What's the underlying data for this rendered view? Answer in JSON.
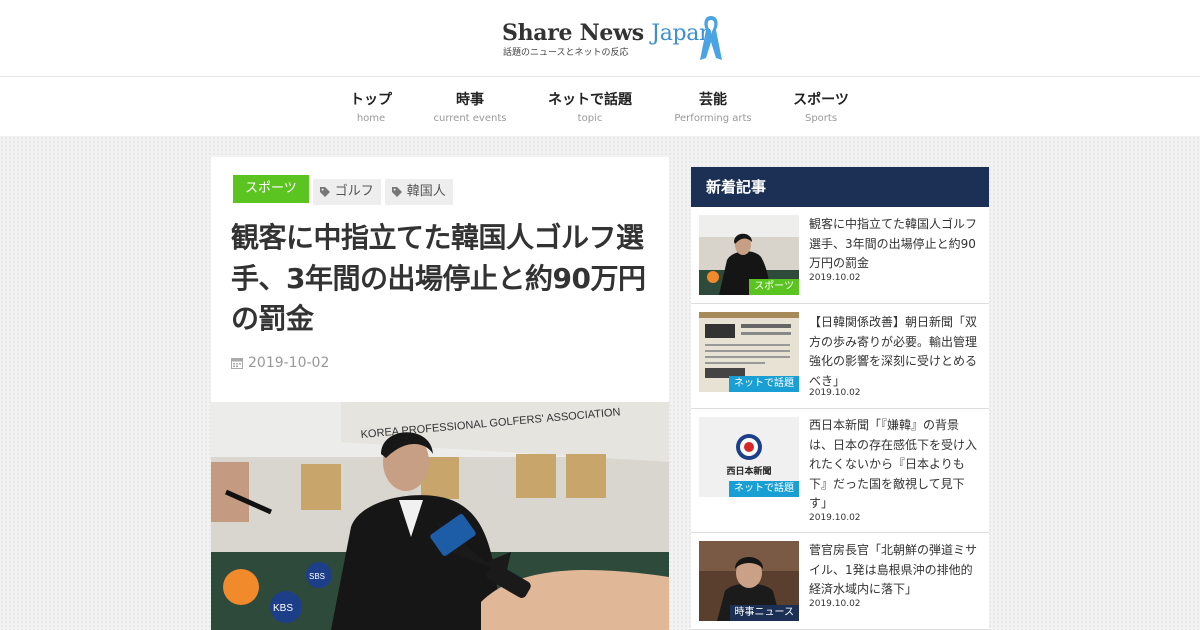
{
  "site": {
    "logo_main": "Share News",
    "logo_accent": "Japan",
    "tagline": "話題のニュースとネットの反応"
  },
  "nav": [
    {
      "label": "トップ",
      "sub": "home"
    },
    {
      "label": "時事",
      "sub": "current events"
    },
    {
      "label": "ネットで話題",
      "sub": "topic"
    },
    {
      "label": "芸能",
      "sub": "Performing arts"
    },
    {
      "label": "スポーツ",
      "sub": "Sports"
    }
  ],
  "article": {
    "category": "スポーツ",
    "tags": [
      "ゴルフ",
      "韓国人"
    ],
    "title": "観客に中指立てた韓国人ゴルフ選手、3年間の出場停止と約90万円の罰金",
    "date": "2019-10-02",
    "hero_backdrop_text": "KOREA PROFESSIONAL GOLFERS' ASSOCIATION",
    "mic_labels": [
      "SBS",
      "KBS",
      "SBS"
    ]
  },
  "sidebar": {
    "heading": "新着記事",
    "items": [
      {
        "title": "観客に中指立てた韓国人ゴルフ選手、3年間の出場停止と約90万円の罰金",
        "date": "2019.10.02",
        "badge": "スポーツ",
        "badge_color": "#5cc421"
      },
      {
        "title": "【日韓関係改善】朝日新聞「双方の歩み寄りが必要。輸出管理強化の影響を深刻に受けとめるべき」",
        "date": "2019.10.02",
        "badge": "ネットで話題",
        "badge_color": "#1a9fd4"
      },
      {
        "title": "西日本新聞「『嫌韓』の背景は、日本の存在感低下を受け入れたくないから『日本よりも下』だった国を敵視して見下す」",
        "date": "2019.10.02",
        "badge": "ネットで話題",
        "badge_color": "#1a9fd4",
        "thumb_text": "西日本新聞"
      },
      {
        "title": "菅官房長官「北朝鮮の弾道ミサイル、1発は島根県沖の排他的経済水域内に落下」",
        "date": "2019.10.02",
        "badge": "時事ニュース",
        "badge_color": "#1c3056"
      }
    ]
  },
  "colors": {
    "accent_blue": "#3d8fd1",
    "sports_green": "#5cc421",
    "topic_blue": "#1a9fd4",
    "navy": "#1c3056"
  }
}
